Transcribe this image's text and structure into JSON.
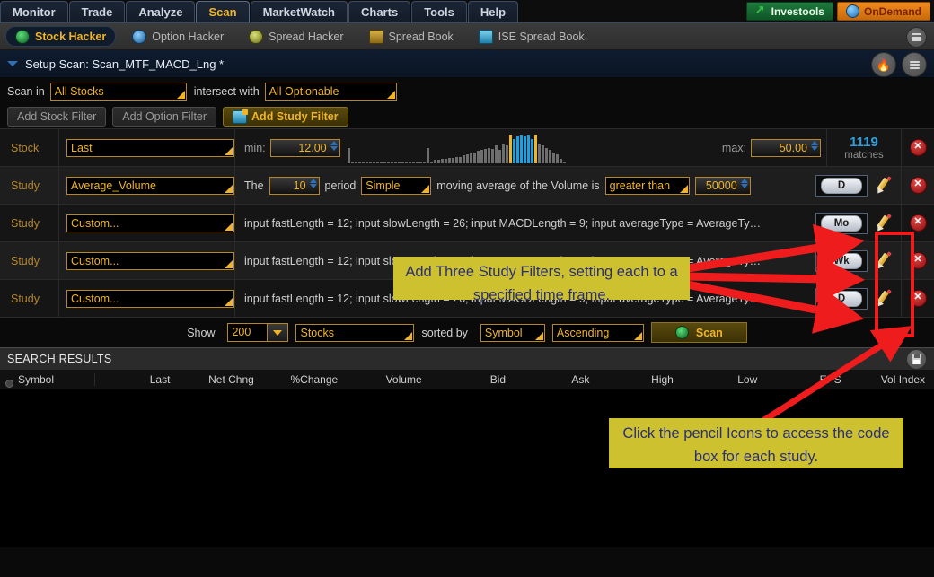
{
  "menu": {
    "tabs": [
      {
        "label": "Monitor",
        "active": false
      },
      {
        "label": "Trade",
        "active": false
      },
      {
        "label": "Analyze",
        "active": false
      },
      {
        "label": "Scan",
        "active": true
      },
      {
        "label": "MarketWatch",
        "active": false
      },
      {
        "label": "Charts",
        "active": false
      },
      {
        "label": "Tools",
        "active": false
      },
      {
        "label": "Help",
        "active": false
      }
    ],
    "brands": [
      {
        "label": "Investools",
        "icon": "arrow-up-right-icon"
      },
      {
        "label": "OnDemand",
        "icon": "globe-icon"
      }
    ]
  },
  "subtoolbar": {
    "items": [
      {
        "label": "Stock Hacker",
        "icon": "stock-hacker-icon",
        "active": true
      },
      {
        "label": "Option Hacker",
        "icon": "option-hacker-icon",
        "active": false
      },
      {
        "label": "Spread Hacker",
        "icon": "spread-hacker-icon",
        "active": false
      },
      {
        "label": "Spread Book",
        "icon": "spread-book-icon",
        "active": false
      },
      {
        "label": "ISE Spread Book",
        "icon": "ise-spread-book-icon",
        "active": false
      }
    ],
    "menu_icon": "hamburger-menu-icon"
  },
  "setup": {
    "title": "Setup Scan: Scan_MTF_MACD_Lng *",
    "collapse_icon": "caret-down-icon",
    "hot_icon": "flame-icon",
    "menu_icon": "hamburger-menu-icon"
  },
  "scan_in": {
    "label": "Scan in",
    "value": "All Stocks",
    "intersect_label": "intersect with",
    "intersect_value": "All Optionable"
  },
  "filter_buttons": {
    "add_stock": "Add Stock Filter",
    "add_option": "Add Option Filter",
    "add_study": "Add Study Filter"
  },
  "rows": [
    {
      "type": "Stock",
      "name": "Last",
      "kind": "range",
      "min_label": "min:",
      "min_value": "12.00",
      "max_label": "max:",
      "max_value": "50.00",
      "matches_count": "1119",
      "matches_label": "matches",
      "delete_icon": "delete-icon"
    },
    {
      "type": "Study",
      "name": "Average_Volume",
      "kind": "moving_average",
      "the_label": "The",
      "period_value": "10",
      "period_label": "period",
      "avg_type": "Simple",
      "mid_text": "moving average of the Volume is",
      "comparison": "greater than",
      "threshold": "50000",
      "timeframe": "D",
      "pencil_icon": "pencil-icon",
      "delete_icon": "delete-icon"
    },
    {
      "type": "Study",
      "name": "Custom...",
      "kind": "custom",
      "code": "input fastLength = 12; input slowLength = 26; input MACDLength = 9; input averageType = AverageTy…",
      "timeframe": "Mo",
      "pencil_icon": "pencil-icon",
      "delete_icon": "delete-icon"
    },
    {
      "type": "Study",
      "name": "Custom...",
      "kind": "custom",
      "code": "input fastLength = 12; input slowLength = 26; input MACDLength = 9; input averageType = AverageTy…",
      "timeframe": "Wk",
      "pencil_icon": "pencil-icon",
      "delete_icon": "delete-icon"
    },
    {
      "type": "Study",
      "name": "Custom...",
      "kind": "custom",
      "code": "input fastLength = 12; input slowLength = 26; input MACDLength = 9; input averageType = AverageTy…",
      "timeframe": "D",
      "pencil_icon": "pencil-icon",
      "delete_icon": "delete-icon"
    }
  ],
  "show": {
    "label": "Show",
    "count": "200",
    "type": "Stocks",
    "sorted_by_label": "sorted by",
    "sort_field": "Symbol",
    "sort_dir": "Ascending",
    "scan_button": "Scan"
  },
  "results": {
    "title": "SEARCH RESULTS",
    "save_icon": "save-disk-icon",
    "columns": [
      "Symbol",
      "Last",
      "Net Chng",
      "%Change",
      "Volume",
      "Bid",
      "Ask",
      "High",
      "Low",
      "EPS",
      "Vol Index"
    ],
    "rows": []
  },
  "annotations": [
    {
      "id": "anno-study-filters",
      "text": "Add Three Study Filters, setting each to a specified time frame."
    },
    {
      "id": "anno-pencil",
      "text": "Click the pencil Icons to access the code box for each study."
    }
  ],
  "colors": {
    "accent_gold": "#f0b429",
    "annotation_bg": "#cdc12f",
    "annotation_fg": "#2b2f7a",
    "arrow_red": "#ee1c1c",
    "match_blue": "#2f9fe0"
  },
  "histogram": {
    "values": [
      14,
      2,
      2,
      2,
      2,
      2,
      2,
      2,
      2,
      2,
      2,
      2,
      2,
      2,
      2,
      2,
      2,
      2,
      2,
      2,
      2,
      2,
      14,
      2,
      3,
      3,
      4,
      4,
      5,
      5,
      6,
      6,
      7,
      8,
      9,
      10,
      11,
      12,
      13,
      14,
      13,
      16,
      12,
      17,
      16,
      18,
      22,
      24,
      26,
      24,
      26,
      22,
      20,
      18,
      16,
      14,
      12,
      10,
      8,
      4,
      2
    ],
    "selected_from": 46,
    "selected_to": 51
  }
}
